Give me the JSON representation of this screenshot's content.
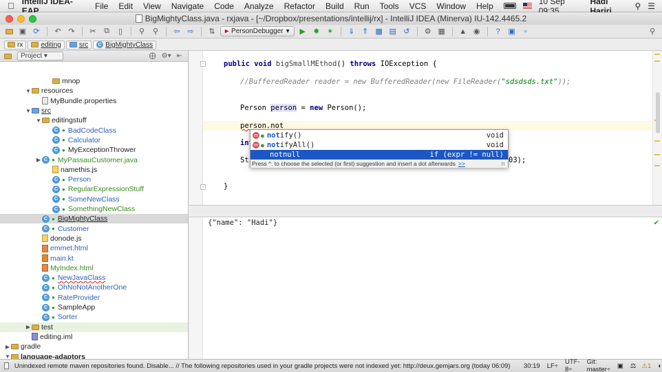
{
  "menubar": {
    "app_name": "IntelliJ IDEA-EAP",
    "items": [
      "File",
      "Edit",
      "View",
      "Navigate",
      "Code",
      "Analyze",
      "Refactor",
      "Build",
      "Run",
      "Tools",
      "VCS",
      "Window",
      "Help"
    ],
    "battery_icon": "battery-icon",
    "datetime": "10 Sep  09:35",
    "user": "Hadi Hariri"
  },
  "window": {
    "title": "BigMightyClass.java - rxjava - [~/Dropbox/presentations/intellij/rx] - IntelliJ IDEA (Minerva) IU-142.4465.2"
  },
  "toolbar": {
    "run_config": "PersonDebugger"
  },
  "navbar": {
    "crumbs": [
      "rx",
      "editing",
      "src",
      "BigMightyClass"
    ]
  },
  "project_panel": {
    "view_mode": "Project",
    "tree": [
      {
        "label": "mnop",
        "indent": 4,
        "icon": "folder",
        "arrow": ""
      },
      {
        "label": "resources",
        "indent": 2,
        "icon": "folder",
        "arrow": "open"
      },
      {
        "label": "MyBundle.properties",
        "indent": 3,
        "icon": "prop",
        "arrow": ""
      },
      {
        "label": "src",
        "indent": 2,
        "icon": "src",
        "arrow": "open",
        "style": "u"
      },
      {
        "label": "editingstuff",
        "indent": 3,
        "icon": "folder",
        "arrow": "open"
      },
      {
        "label": "BadCodeClass",
        "indent": 4,
        "icon": "class",
        "arrow": "",
        "style": "blue"
      },
      {
        "label": "Calculator",
        "indent": 4,
        "icon": "class",
        "arrow": "",
        "style": "blue"
      },
      {
        "label": "MyExceptionThrower",
        "indent": 4,
        "icon": "class",
        "arrow": ""
      },
      {
        "label": "MyPassauCustomer.java",
        "indent": 3,
        "icon": "class",
        "arrow": "closed",
        "style": "green"
      },
      {
        "label": "namethis.js",
        "indent": 4,
        "icon": "js",
        "arrow": ""
      },
      {
        "label": "Person",
        "indent": 4,
        "icon": "class",
        "arrow": "",
        "style": "blue"
      },
      {
        "label": "RegularExpressionStuff",
        "indent": 4,
        "icon": "class",
        "arrow": "",
        "style": "green"
      },
      {
        "label": "SomeNewClass",
        "indent": 4,
        "icon": "class",
        "arrow": "",
        "style": "blue"
      },
      {
        "label": "SomethingNewClass",
        "indent": 4,
        "icon": "class",
        "arrow": "",
        "style": "green"
      },
      {
        "label": "BigMightyClass",
        "indent": 3,
        "icon": "class",
        "arrow": "",
        "style": "u",
        "selected": true
      },
      {
        "label": "Customer",
        "indent": 3,
        "icon": "class",
        "arrow": "",
        "style": "blue"
      },
      {
        "label": "donode.js",
        "indent": 3,
        "icon": "js",
        "arrow": ""
      },
      {
        "label": "emmet.html",
        "indent": 3,
        "icon": "html",
        "arrow": "",
        "style": "blue"
      },
      {
        "label": "main.kt",
        "indent": 3,
        "icon": "kt",
        "arrow": "",
        "style": "blue"
      },
      {
        "label": "MyIndex.html",
        "indent": 3,
        "icon": "html",
        "arrow": "",
        "style": "green"
      },
      {
        "label": "NewJavaClass",
        "indent": 3,
        "icon": "class",
        "arrow": "",
        "style": "red-u"
      },
      {
        "label": "OhNoNotAnotherOne",
        "indent": 3,
        "icon": "class",
        "arrow": "",
        "style": "blue"
      },
      {
        "label": "RateProvider",
        "indent": 3,
        "icon": "class",
        "arrow": "",
        "style": "blue"
      },
      {
        "label": "SampleApp",
        "indent": 3,
        "icon": "class",
        "arrow": ""
      },
      {
        "label": "Sorter",
        "indent": 3,
        "icon": "class",
        "arrow": "",
        "style": "blue"
      },
      {
        "label": "test",
        "indent": 2,
        "icon": "folder",
        "arrow": "closed",
        "highlight": true
      },
      {
        "label": "editing.iml",
        "indent": 2,
        "icon": "iml",
        "arrow": ""
      },
      {
        "label": "gradle",
        "indent": 0,
        "icon": "folder",
        "arrow": "closed"
      },
      {
        "label": "language-adaptors",
        "indent": 0,
        "icon": "folder",
        "arrow": "open",
        "style": "bold"
      },
      {
        "label": "rxjava-clojure",
        "indent": 1,
        "icon": "folder",
        "arrow": "open",
        "style": "bold"
      }
    ]
  },
  "editor": {
    "method_sig": {
      "kw1": "public",
      "kw2": "void",
      "name": "bigSmallMEthod",
      "rest": "() ",
      "kw3": "throws",
      "exc": " IOException {"
    },
    "comment": {
      "pre": "//BufferedReader reader = new BufferedReader(new FileReader(",
      "str": "\"sdsdsds.txt\"",
      "post": "));"
    },
    "person_line": {
      "type": "Person ",
      "var": "person",
      "eq": " = ",
      "kw": "new",
      "rest": " Person();"
    },
    "typing_line": "person.not",
    "hidden_line_a": "int",
    "hidden_line_b": "St",
    "hidden_line_b_tail": "03);",
    "closing_brace": "}"
  },
  "autocomplete": {
    "suggestions": [
      {
        "prefix": "not",
        "rest": "ify()",
        "type": "void",
        "active": false
      },
      {
        "prefix": "not",
        "rest": "ifyAll()",
        "type": "void",
        "active": false
      },
      {
        "prefix": "",
        "rest": "notnull",
        "type": "if (expr != null)",
        "active": true
      }
    ],
    "hint": "Press ^. to choose the selected (or first) suggestion and insert a dot afterwards",
    "hint_more": ">>",
    "hint_icon": "π"
  },
  "output": {
    "text": "{\"name\": \"Hadi\"}"
  },
  "statusbar": {
    "message": "Unindexed remote maven repositories found. Disable... // The following repositories used in your gradle projects were not indexed yet: http://deux.gemjars.org (today 06:09)",
    "position": "30:19",
    "line_sep": "LF÷",
    "encoding": "UTF-8÷",
    "git": "Git: master÷",
    "warnings": "1"
  },
  "colors": {
    "selection": "#1c57c4",
    "keyword": "#000080",
    "comment": "#808080",
    "string": "#008000",
    "caret_line": "#fffae3"
  }
}
